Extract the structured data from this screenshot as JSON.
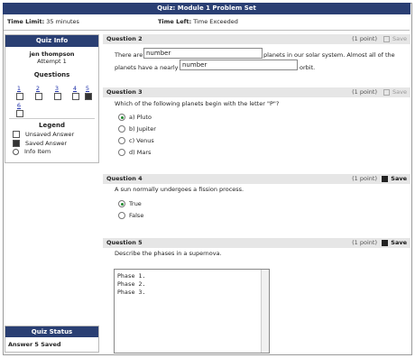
{
  "title": "Quiz: Module 1 Problem Set",
  "limits": {
    "time_limit_label": "Time Limit:",
    "time_limit_value": "35 minutes",
    "time_left_label": "Time Left:",
    "time_left_value": "Time Exceeded"
  },
  "sidebar": {
    "header": "Quiz Info",
    "user": "jen thompson",
    "attempt": "Attempt 1",
    "questions_label": "Questions",
    "question_numbers": [
      "1",
      "2",
      "3",
      "4",
      "5",
      "6"
    ],
    "legend_title": "Legend",
    "legend": [
      {
        "label": "Unsaved Answer",
        "icon": "unsaved-answer-icon"
      },
      {
        "label": "Saved Answer",
        "icon": "saved-answer-icon"
      },
      {
        "label": "Info Item",
        "icon": "info-item-icon"
      }
    ]
  },
  "quiz_status": {
    "header": "Quiz Status",
    "message": "Answer 5 Saved"
  },
  "questions": [
    {
      "title": "Question 2",
      "points": "(1 point)",
      "save": "Save",
      "prompt_a": "There are",
      "blank1": "number",
      "prompt_b": "planets in our solar system. Almost all of the",
      "prompt_c": "planets have a nearly",
      "blank2": "number",
      "prompt_d": "orbit."
    },
    {
      "title": "Question 3",
      "points": "(1 point)",
      "save": "Save",
      "prompt": "Which of the following planets begin with the letter \"P\"?",
      "options": [
        "a) Pluto",
        "b) Jupiter",
        "c) Venus",
        "d) Mars"
      ]
    },
    {
      "title": "Question 4",
      "points": "(1 point)",
      "save": "Save",
      "prompt": "A sun normally undergoes a fission process.",
      "options": [
        "True",
        "False"
      ]
    },
    {
      "title": "Question 5",
      "points": "(1 point)",
      "save": "Save",
      "prompt": "Describe the phases in a supernova.",
      "answer_lines": [
        "Phase 1.",
        "Phase 2.",
        "Phase 3."
      ]
    }
  ]
}
